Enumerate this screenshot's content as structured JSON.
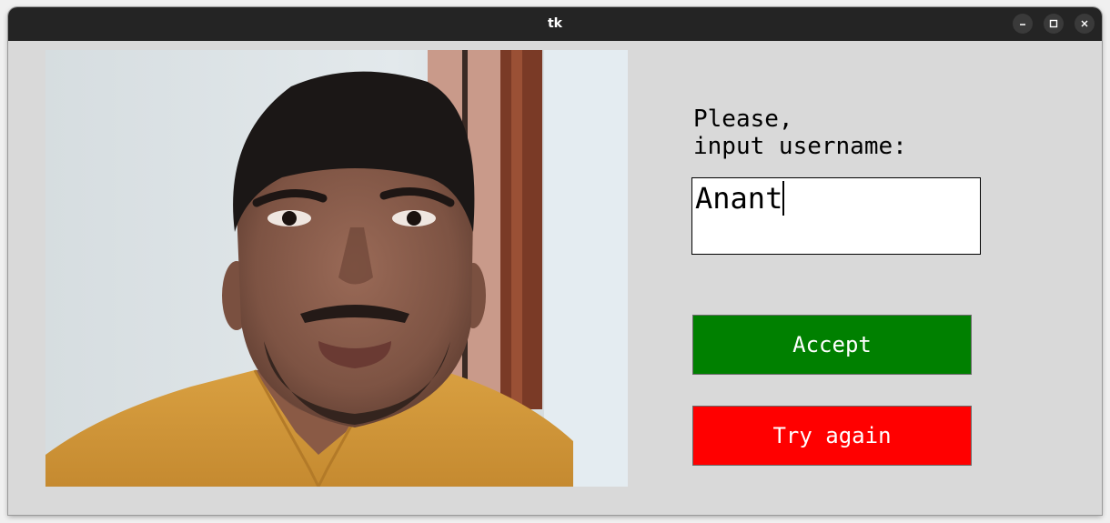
{
  "window": {
    "title": "tk",
    "controls": {
      "minimize_icon": "minimize-icon",
      "maximize_icon": "maximize-icon",
      "close_icon": "close-icon"
    }
  },
  "camera": {
    "image": "webcam-photo-of-person"
  },
  "form": {
    "prompt": "Please,\ninput username:",
    "username_value": "Anant"
  },
  "buttons": {
    "accept_label": "Accept",
    "try_again_label": "Try again"
  },
  "colors": {
    "window_background": "#d9d9d9",
    "titlebar": "#242424",
    "accept": "#008000",
    "try_again": "#ff0000"
  }
}
